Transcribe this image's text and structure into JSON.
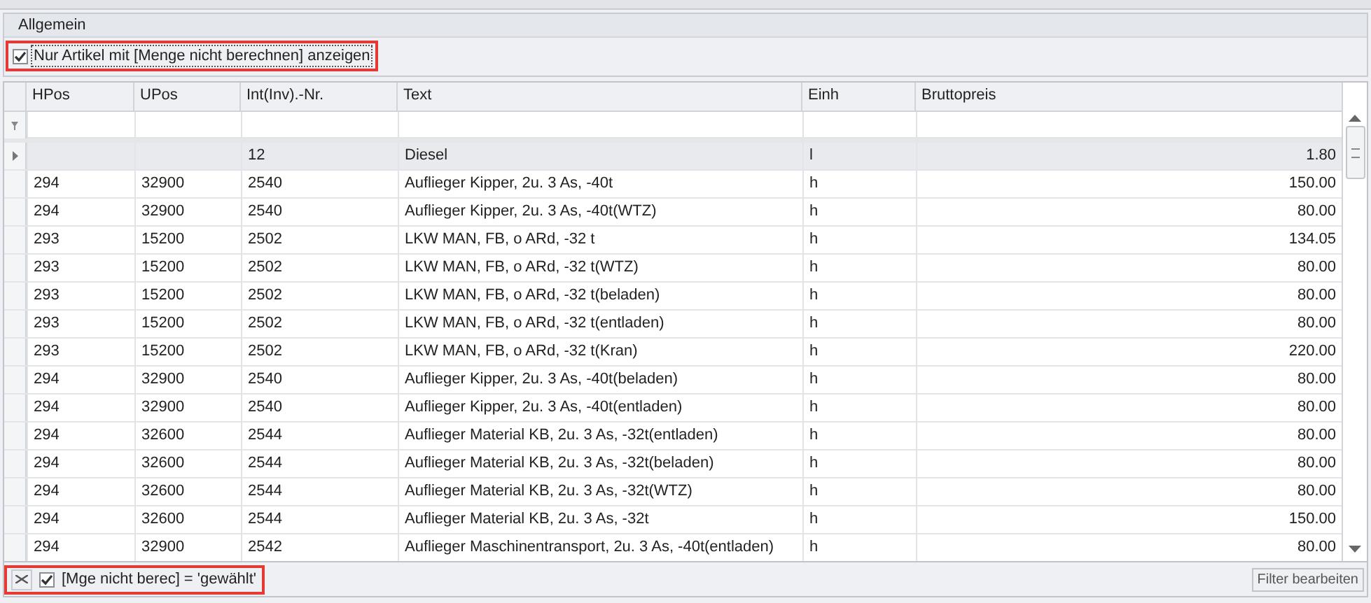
{
  "group": {
    "title": "Allgemein"
  },
  "option": {
    "label": "Nur Artikel mit [Menge nicht berechnen] anzeigen",
    "checked": true,
    "highlighted": true
  },
  "table": {
    "columns": [
      "HPos",
      "UPos",
      "Int(Inv).-Nr.",
      "Text",
      "Einh",
      "Bruttopreis"
    ],
    "rows": [
      {
        "cells": [
          "",
          "",
          "12",
          "Diesel",
          "l",
          "1.80"
        ],
        "selected": true
      },
      {
        "cells": [
          "294",
          "32900",
          "2540",
          "Auflieger Kipper, 2u. 3 As, -40t",
          "h",
          "150.00"
        ],
        "selected": false
      },
      {
        "cells": [
          "294",
          "32900",
          "2540",
          "Auflieger Kipper, 2u. 3 As, -40t(WTZ)",
          "h",
          "80.00"
        ],
        "selected": false
      },
      {
        "cells": [
          "293",
          "15200",
          "2502",
          "LKW MAN, FB, o ARd, -32 t",
          "h",
          "134.05"
        ],
        "selected": false
      },
      {
        "cells": [
          "293",
          "15200",
          "2502",
          "LKW MAN, FB, o ARd, -32 t(WTZ)",
          "h",
          "80.00"
        ],
        "selected": false
      },
      {
        "cells": [
          "293",
          "15200",
          "2502",
          "LKW MAN, FB, o ARd, -32 t(beladen)",
          "h",
          "80.00"
        ],
        "selected": false
      },
      {
        "cells": [
          "293",
          "15200",
          "2502",
          "LKW MAN, FB, o ARd, -32 t(entladen)",
          "h",
          "80.00"
        ],
        "selected": false
      },
      {
        "cells": [
          "293",
          "15200",
          "2502",
          "LKW MAN, FB, o ARd, -32 t(Kran)",
          "h",
          "220.00"
        ],
        "selected": false
      },
      {
        "cells": [
          "294",
          "32900",
          "2540",
          "Auflieger Kipper, 2u. 3 As, -40t(beladen)",
          "h",
          "80.00"
        ],
        "selected": false
      },
      {
        "cells": [
          "294",
          "32900",
          "2540",
          "Auflieger Kipper, 2u. 3 As, -40t(entladen)",
          "h",
          "80.00"
        ],
        "selected": false
      },
      {
        "cells": [
          "294",
          "32600",
          "2544",
          "Auflieger Material  KB, 2u. 3 As, -32t(entladen)",
          "h",
          "80.00"
        ],
        "selected": false
      },
      {
        "cells": [
          "294",
          "32600",
          "2544",
          "Auflieger Material  KB, 2u. 3 As, -32t(beladen)",
          "h",
          "80.00"
        ],
        "selected": false
      },
      {
        "cells": [
          "294",
          "32600",
          "2544",
          "Auflieger Material  KB, 2u. 3 As, -32t(WTZ)",
          "h",
          "80.00"
        ],
        "selected": false
      },
      {
        "cells": [
          "294",
          "32600",
          "2544",
          "Auflieger Material  KB, 2u. 3 As, -32t",
          "h",
          "150.00"
        ],
        "selected": false
      },
      {
        "cells": [
          "294",
          "32900",
          "2542",
          "Auflieger Maschinentransport, 2u. 3 As, -40t(entladen)",
          "h",
          "80.00"
        ],
        "selected": false
      }
    ]
  },
  "filter_bar": {
    "text": "[Mge nicht berec] = 'gewählt'",
    "checked": true,
    "highlighted": true,
    "button": "Filter bearbeiten"
  }
}
